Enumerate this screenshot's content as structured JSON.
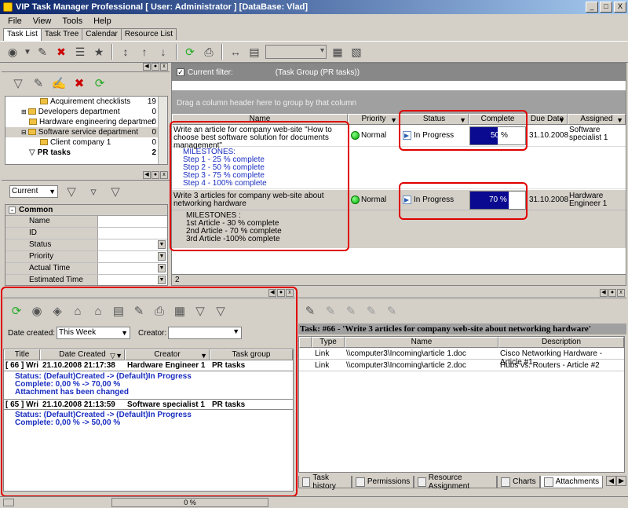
{
  "window": {
    "title": "VIP Task Manager Professional [ User: Administrator ] [DataBase: Vlad]",
    "minimize": "_",
    "maximize": "□",
    "close": "X"
  },
  "menu": [
    "File",
    "View",
    "Tools",
    "Help"
  ],
  "tabs": [
    "Task List",
    "Task Tree",
    "Calendar",
    "Resource List"
  ],
  "tree": {
    "items": [
      {
        "label": "Acquirement checklists",
        "count": "19"
      },
      {
        "label": "Developers department",
        "count": "0"
      },
      {
        "label": "Hardware engineering departmer",
        "count": "0"
      },
      {
        "label": "Software service department",
        "count": "0"
      },
      {
        "label": "Client company 1",
        "count": "0"
      },
      {
        "label": "PR tasks",
        "count": "2"
      }
    ]
  },
  "filter_panel": {
    "current_combo": "Current"
  },
  "properties": {
    "group": "Common",
    "rows": [
      "Name",
      "ID",
      "Status",
      "Priority",
      "Actual Time",
      "Estimated Time"
    ]
  },
  "task_grid": {
    "current_filter_label": "Current filter:",
    "current_filter_value": "(Task Group  (PR tasks))",
    "group_hint": "Drag a column header here to group by that column",
    "columns": [
      "Name",
      "Priority",
      "Status",
      "Complete",
      "Due Date",
      "Assigned"
    ],
    "rows": [
      {
        "name": "Write an article for company web-site \"How to choose best software solution for documents management\"",
        "priority": "Normal",
        "status": "In Progress",
        "complete_value": 50,
        "complete_num": "50",
        "complete_unit": "%",
        "due": "31.10.2008",
        "assigned": "Software specialist 1",
        "milestones_title": "MILESTONES:",
        "milestones": [
          "Step 1 - 25 % complete",
          "Step 2 - 50 % complete",
          "Step 3 - 75 % complete",
          "Step 4 - 100% complete"
        ]
      },
      {
        "name": "Write 3 articles for company web-site about networking hardware",
        "priority": "Normal",
        "status": "In Progress",
        "complete_value": 70,
        "complete_text": "70 %",
        "due": "31.10.2008",
        "assigned": "Hardware Engineer 1",
        "milestones_title": "MILESTONES :",
        "milestones": [
          "1st Article - 30 % complete",
          "2nd Article - 70 % complete",
          "3rd Article -100% complete"
        ]
      }
    ],
    "footer_count": "2"
  },
  "history": {
    "date_created_label": "Date created:",
    "date_created_value": "This Week",
    "creator_label": "Creator:",
    "columns": [
      "Title",
      "Date Created",
      "Creator",
      "Task group"
    ],
    "records": [
      {
        "title": "[ 66 ] Wri",
        "date": "21.10.2008 21:17:38",
        "creator": "Hardware Engineer 1",
        "group": "PR tasks",
        "lines": [
          "Status: (Default)Created -> (Default)In Progress",
          "Complete: 0,00 % -> 70,00 %",
          "Attachment has been changed"
        ]
      },
      {
        "title": "[ 65 ] Wri",
        "date": "21.10.2008 21:13:59",
        "creator": "Software specialist 1",
        "group": "PR tasks",
        "lines": [
          "Status: (Default)Created -> (Default)In Progress",
          "Complete: 0,00 % -> 50,00 %"
        ]
      }
    ]
  },
  "attachments": {
    "task_title": "Task: #66 - 'Write 3 articles for company web-site about networking hardware'",
    "columns": [
      "Type",
      "Name",
      "Description"
    ],
    "rows": [
      {
        "type": "Link",
        "name": "\\\\computer3\\Incoming\\article 1.doc",
        "desc": "Cisco Networking Hardware - Article #1"
      },
      {
        "type": "Link",
        "name": "\\\\computer3\\Incoming\\article 2.doc",
        "desc": "Hubs vs. Routers - Article #2"
      }
    ],
    "tabs": [
      "Task history",
      "Permissions",
      "Resource Assignment",
      "Charts",
      "Attachments"
    ]
  },
  "statusbar": {
    "progress_text": "0 %"
  }
}
